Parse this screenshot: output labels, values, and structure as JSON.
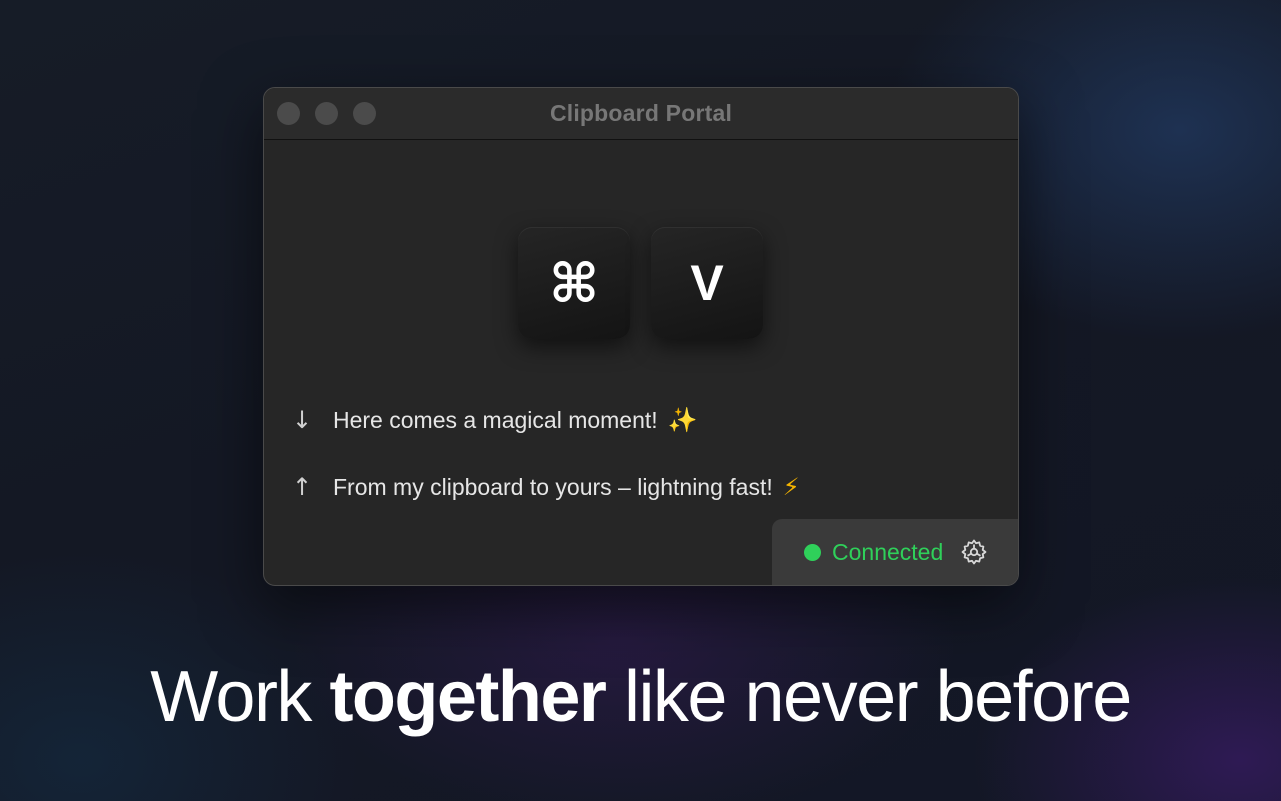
{
  "window": {
    "title": "Clipboard Portal"
  },
  "keys": {
    "modifier": "⌘",
    "letter": "V"
  },
  "messages": [
    {
      "icon": "arrow-down-icon",
      "arrow": "↓",
      "text": "Here comes a magical moment!",
      "emoji": "✨"
    },
    {
      "icon": "arrow-up-icon",
      "arrow": "↑",
      "text": "From my clipboard to yours – lightning fast!",
      "emoji": "⚡"
    }
  ],
  "status": {
    "label": "Connected",
    "color": "#2fd05a"
  },
  "headline": {
    "part1": "Work ",
    "bold": "together",
    "part2": " like never before"
  }
}
